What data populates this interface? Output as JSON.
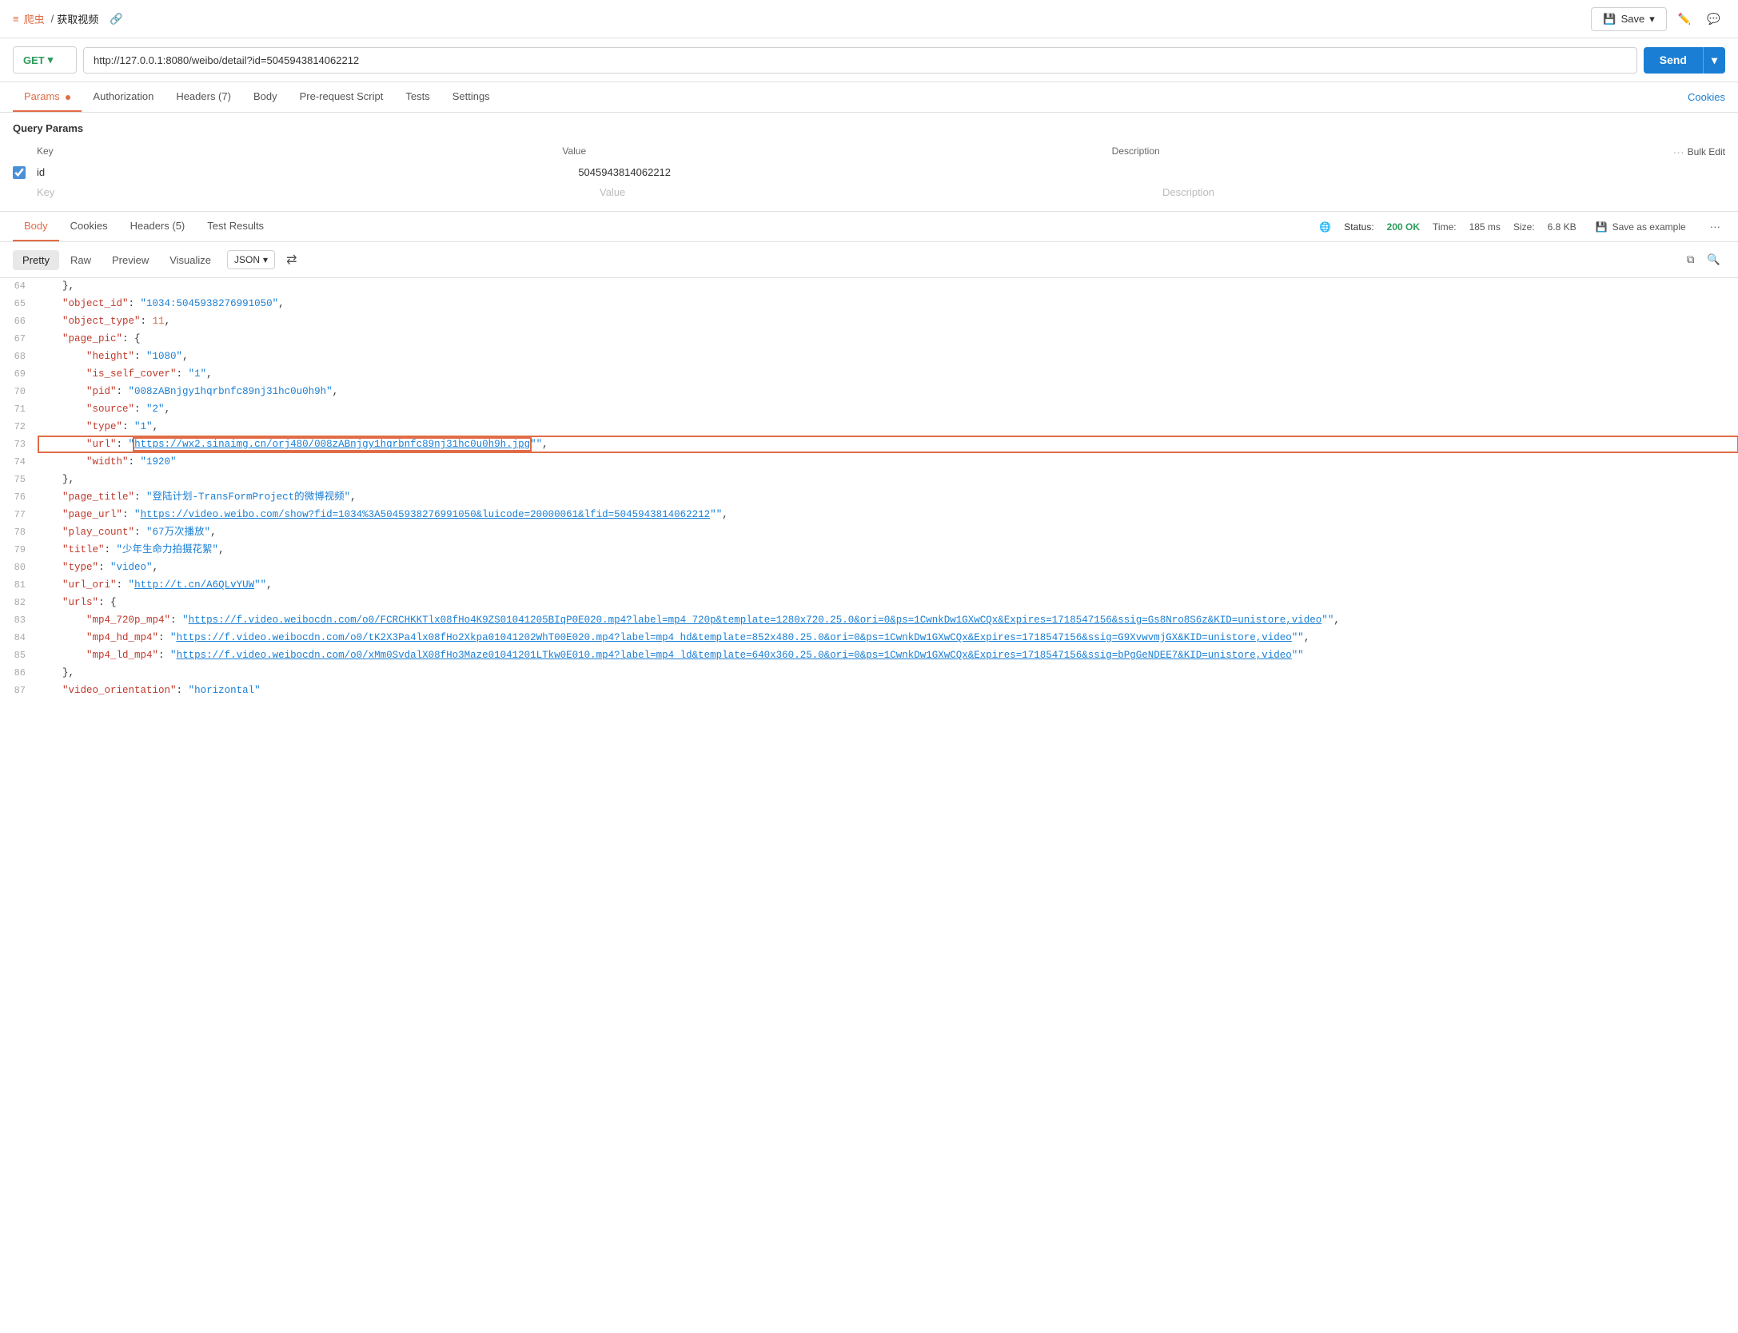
{
  "topbar": {
    "brand_icon": "≡",
    "brand_name": "爬虫",
    "separator": "/",
    "current_page": "获取视频",
    "save_label": "Save",
    "save_icon": "💾"
  },
  "url_bar": {
    "method": "GET",
    "url": "http://127.0.0.1:8080/weibo/detail?id=5045943814062212",
    "send_label": "Send"
  },
  "request_tabs": {
    "params_label": "Params",
    "params_dot": true,
    "auth_label": "Authorization",
    "headers_label": "Headers",
    "headers_count": 7,
    "body_label": "Body",
    "prerequest_label": "Pre-request Script",
    "tests_label": "Tests",
    "settings_label": "Settings",
    "cookies_label": "Cookies"
  },
  "query_params": {
    "title": "Query Params",
    "col_key": "Key",
    "col_value": "Value",
    "col_description": "Description",
    "bulk_edit": "Bulk Edit",
    "rows": [
      {
        "checked": true,
        "key": "id",
        "value": "5045943814062212",
        "description": ""
      }
    ],
    "empty_row": {
      "key": "Key",
      "value": "Value",
      "description": "Description"
    }
  },
  "response_tabs": {
    "body_label": "Body",
    "body_active": true,
    "cookies_label": "Cookies",
    "headers_label": "Headers",
    "headers_count": 5,
    "test_results_label": "Test Results",
    "status_label": "Status:",
    "status_value": "200 OK",
    "time_label": "Time:",
    "time_value": "185 ms",
    "size_label": "Size:",
    "size_value": "6.8 KB",
    "save_example_label": "Save as example"
  },
  "format_tabs": {
    "pretty_label": "Pretty",
    "raw_label": "Raw",
    "preview_label": "Preview",
    "visualize_label": "Visualize",
    "format_json": "JSON",
    "copy_icon": "⧉",
    "search_icon": "🔍"
  },
  "json_lines": [
    {
      "num": 64,
      "content": "    },",
      "type": "bracket"
    },
    {
      "num": 65,
      "content": "    \"object_id\": \"1034:5045938276991050\",",
      "type": "keystring"
    },
    {
      "num": 66,
      "content": "    \"object_type\": 11,",
      "type": "keynumber"
    },
    {
      "num": 67,
      "content": "    \"page_pic\": {",
      "type": "keyobject"
    },
    {
      "num": 68,
      "content": "        \"height\": \"1080\",",
      "type": "keystring"
    },
    {
      "num": 69,
      "content": "        \"is_self_cover\": \"1\",",
      "type": "keystring"
    },
    {
      "num": 70,
      "content": "        \"pid\": \"008zABnjgy1hqrbnfc89nj31hc0u0h9h\",",
      "type": "keystring"
    },
    {
      "num": 71,
      "content": "        \"source\": \"2\",",
      "type": "keystring"
    },
    {
      "num": 72,
      "content": "        \"type\": \"1\",",
      "type": "keystring"
    },
    {
      "num": 73,
      "content": "        \"url\": \"https://wx2.sinaimg.cn/orj480/008zABnjgy1hqrbnfc89nj31hc0u0h9h.jpg\",",
      "type": "keylink",
      "highlighted": true
    },
    {
      "num": 74,
      "content": "        \"width\": \"1920\"",
      "type": "keystring"
    },
    {
      "num": 75,
      "content": "    },",
      "type": "bracket"
    },
    {
      "num": 76,
      "content": "    \"page_title\": \"登陆计划-TransFormProject的微博视频\",",
      "type": "keystring"
    },
    {
      "num": 77,
      "content": "    \"page_url\": \"https://video.weibo.com/show?fid=1034%3A5045938276991050&luicode=20000061&lfid=5045943814062212\",",
      "type": "keylink"
    },
    {
      "num": 78,
      "content": "    \"play_count\": \"67万次播放\",",
      "type": "keystring"
    },
    {
      "num": 79,
      "content": "    \"title\": \"少年生命力拍摄花絮\",",
      "type": "keystring"
    },
    {
      "num": 80,
      "content": "    \"type\": \"video\",",
      "type": "keystring"
    },
    {
      "num": 81,
      "content": "    \"url_ori\": \"http://t.cn/A6QLvYUW\",",
      "type": "keylink"
    },
    {
      "num": 82,
      "content": "    \"urls\": {",
      "type": "keyobject"
    },
    {
      "num": 83,
      "content": "        \"mp4_720p_mp4\": \"https://f.video.weibocdn.com/o0/FCRCHKKTlx08fHo4K9ZS01041205BIqP0E020.mp4?label=mp4_720p&template=1280x720.25.0&ori=0&ps=1CwnkDw1GXwCQx&Expires=1718547156&ssig=Gs8Nro8S6z&KID=unistore,video\",",
      "type": "keylink"
    },
    {
      "num": 84,
      "content": "        \"mp4_hd_mp4\": \"https://f.video.weibocdn.com/o0/tK2X3Pa4lx08fHo2Xkpa01041202WhT00E020.mp4?label=mp4_hd&template=852x480.25.0&ori=0&ps=1CwnkDw1GXwCQx&Expires=1718547156&ssig=G9XvwvmjGX&KID=unistore,video\",",
      "type": "keylink"
    },
    {
      "num": 85,
      "content": "        \"mp4_ld_mp4\": \"https://f.video.weibocdn.com/o0/xMm0SvdalX08fHo3Maze01041201LTkw0E010.mp4?label=mp4_ld&template=640x360.25.0&ori=0&ps=1CwnkDw1GXwCQx&Expires=1718547156&ssig=bPgGeNDEE7&KID=unistore,video\"",
      "type": "keylink"
    },
    {
      "num": 86,
      "content": "    },",
      "type": "bracket"
    },
    {
      "num": 87,
      "content": "    \"video_orientation\": \"horizontal\"",
      "type": "keystring_last"
    }
  ]
}
